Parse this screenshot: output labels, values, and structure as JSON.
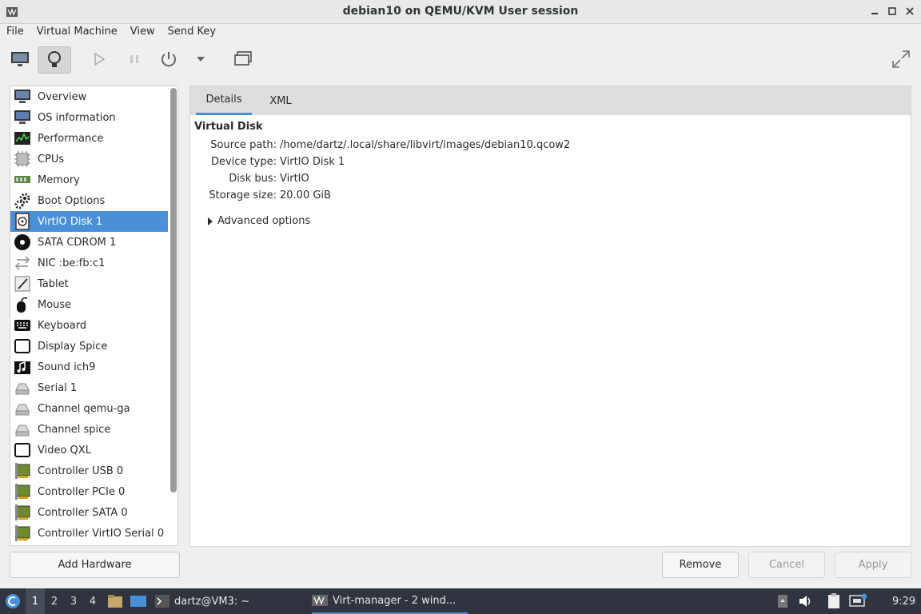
{
  "window": {
    "title": "debian10 on QEMU/KVM User session"
  },
  "menu": [
    "File",
    "Virtual Machine",
    "View",
    "Send Key"
  ],
  "hardware": [
    {
      "label": "Overview",
      "icon": "monitor-icon"
    },
    {
      "label": "OS information",
      "icon": "os-info-icon"
    },
    {
      "label": "Performance",
      "icon": "performance-graph-icon"
    },
    {
      "label": "CPUs",
      "icon": "cpu-chip-icon"
    },
    {
      "label": "Memory",
      "icon": "memory-module-icon"
    },
    {
      "label": "Boot Options",
      "icon": "gears-icon"
    },
    {
      "label": "VirtIO Disk 1",
      "icon": "hard-disk-icon"
    },
    {
      "label": "SATA CDROM 1",
      "icon": "cdrom-icon"
    },
    {
      "label": "NIC :be:fb:c1",
      "icon": "network-arrows-icon"
    },
    {
      "label": "Tablet",
      "icon": "tablet-icon"
    },
    {
      "label": "Mouse",
      "icon": "mouse-icon"
    },
    {
      "label": "Keyboard",
      "icon": "keyboard-icon"
    },
    {
      "label": "Display Spice",
      "icon": "display-icon"
    },
    {
      "label": "Sound ich9",
      "icon": "sound-icon"
    },
    {
      "label": "Serial 1",
      "icon": "serial-icon"
    },
    {
      "label": "Channel qemu-ga",
      "icon": "channel-icon"
    },
    {
      "label": "Channel spice",
      "icon": "channel-icon"
    },
    {
      "label": "Video QXL",
      "icon": "video-icon"
    },
    {
      "label": "Controller USB 0",
      "icon": "controller-card-icon"
    },
    {
      "label": "Controller PCIe 0",
      "icon": "controller-card-icon"
    },
    {
      "label": "Controller SATA 0",
      "icon": "controller-card-icon"
    },
    {
      "label": "Controller VirtIO Serial 0",
      "icon": "controller-card-icon"
    }
  ],
  "add_hardware_label": "Add Hardware",
  "tabs": [
    "Details",
    "XML"
  ],
  "details": {
    "section_title": "Virtual Disk",
    "rows": [
      {
        "label": "Source path:",
        "value": "/home/dartz/.local/share/libvirt/images/debian10.qcow2"
      },
      {
        "label": "Device type:",
        "value": "VirtIO Disk 1"
      },
      {
        "label": "Disk bus:",
        "value": "VirtIO"
      },
      {
        "label": "Storage size:",
        "value": "20.00 GiB"
      }
    ],
    "advanced_label": "Advanced options"
  },
  "buttons": {
    "remove": "Remove",
    "cancel": "Cancel",
    "apply": "Apply"
  },
  "taskbar": {
    "workspaces": [
      "1",
      "2",
      "3",
      "4"
    ],
    "terminal_task": "dartz@VM3: ~",
    "virt_task": "Virt-manager - 2 wind...",
    "clock": "9:29"
  },
  "colors": {
    "accent": "#4a90d9",
    "taskbar_bg": "#2f343f",
    "selection": "#4a90d9"
  }
}
